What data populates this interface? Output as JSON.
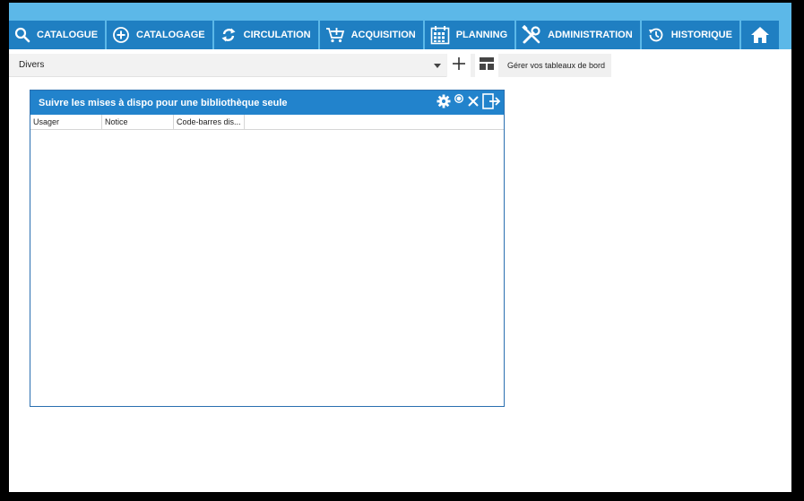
{
  "nav": {
    "items": [
      {
        "label": "CATALOGUE",
        "icon": "search-icon"
      },
      {
        "label": "CATALOGAGE",
        "icon": "plus-circle-icon"
      },
      {
        "label": "CIRCULATION",
        "icon": "refresh-icon"
      },
      {
        "label": "ACQUISITION",
        "icon": "cart-icon"
      },
      {
        "label": "PLANNING",
        "icon": "calendar-icon"
      },
      {
        "label": "ADMINISTRATION",
        "icon": "tools-icon"
      },
      {
        "label": "HISTORIQUE",
        "icon": "history-icon"
      },
      {
        "label": "",
        "icon": "home-icon"
      }
    ]
  },
  "toolbar": {
    "dashboard_select": "Divers",
    "add_icon": "plus-icon",
    "layout_icon": "layout-icon",
    "manage_label": "Gérer vos tableaux de bord"
  },
  "widget": {
    "title": "Suivre les mises à dispo pour une bibliothèque seule",
    "actions": [
      "gear-icon",
      "refresh-small-icon",
      "close-icon",
      "popout-icon"
    ],
    "columns": [
      "Usager",
      "Notice",
      "Code-barres dis..."
    ],
    "rows": []
  },
  "colors": {
    "nav_bg": "#1f7fc2",
    "topbar": "#5cb8e8",
    "widget_header": "#2283cc"
  }
}
